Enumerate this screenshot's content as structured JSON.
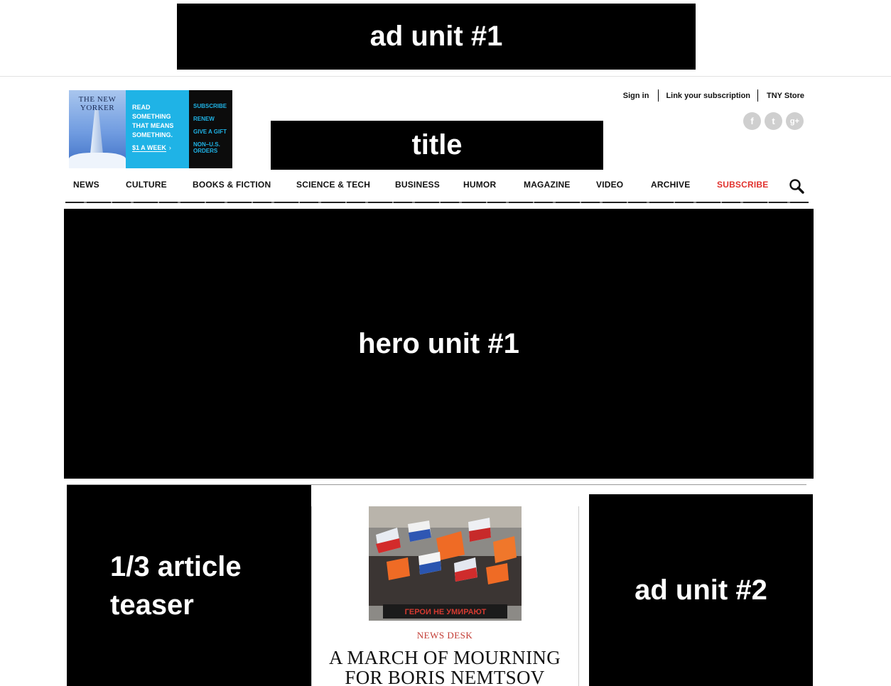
{
  "ads": {
    "top_label": "ad unit #1",
    "side_label": "ad unit #2"
  },
  "promo": {
    "cover_masthead": "THE NEW YORKER",
    "pitch_lines": [
      "READ",
      "SOMETHING",
      "THAT MEANS",
      "SOMETHING."
    ],
    "price": "$1 A WEEK",
    "price_arrow": "›",
    "links": [
      "SUBSCRIBE",
      "RENEW",
      "GIVE A GIFT",
      "NON–U.S. ORDERS"
    ],
    "colors": {
      "middle": "#1fb3e6",
      "right": "#0c0c0c"
    }
  },
  "header": {
    "title_placeholder": "title",
    "account_links": [
      "Sign in",
      "Link your subscription",
      "TNY Store"
    ],
    "social": [
      {
        "icon": "facebook-icon",
        "glyph": "f"
      },
      {
        "icon": "twitter-icon",
        "glyph": "t"
      },
      {
        "icon": "google-plus-icon",
        "glyph": "g+"
      }
    ]
  },
  "nav": {
    "items": [
      "NEWS",
      "CULTURE",
      "BOOKS & FICTION",
      "SCIENCE & TECH",
      "BUSINESS",
      "HUMOR",
      "MAGAZINE",
      "VIDEO",
      "ARCHIVE",
      "SUBSCRIBE"
    ],
    "highlight_color": "#e1312d",
    "search_icon": "search-icon"
  },
  "hero": {
    "label": "hero unit #1"
  },
  "teaser": {
    "lines": [
      "1/3 article",
      "teaser"
    ]
  },
  "story": {
    "rubric": "NEWS DESK",
    "headline": "A MARCH OF MOURNING FOR BORIS NEMTSOV",
    "photo_banner_text": "ГЕРОИ НЕ УМИРАЮТ"
  }
}
